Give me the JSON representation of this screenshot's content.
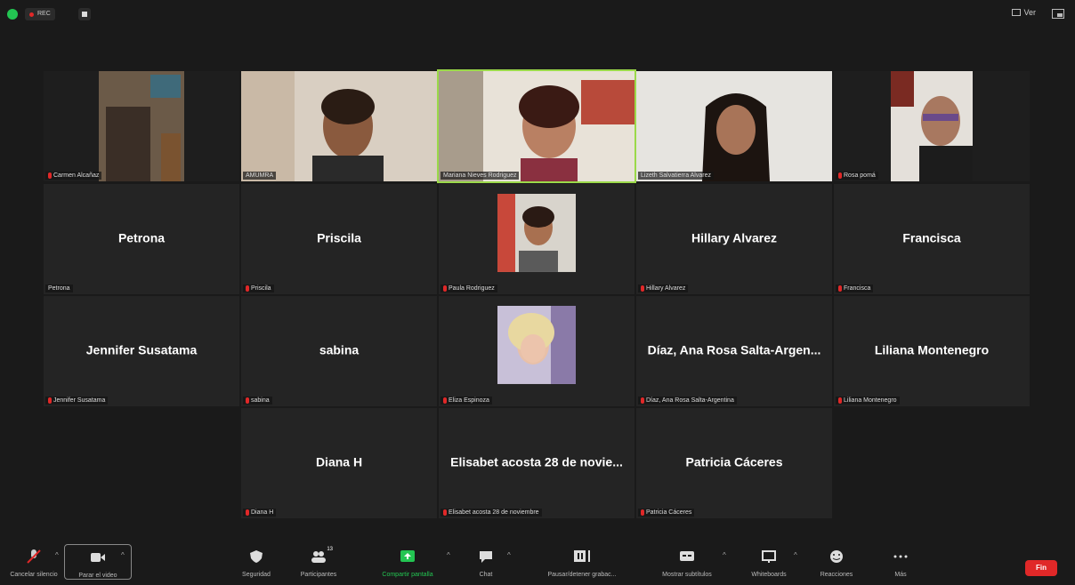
{
  "top_bar": {
    "recording_label": "REC",
    "view_label": "Ver"
  },
  "video_tiles": [
    {
      "name": "Carmen Alcañaz"
    },
    {
      "name": "AMUMRA"
    },
    {
      "name": "Mariana Nieves Rodriguez"
    },
    {
      "name": "Lizeth Salvatierra Alvarez"
    },
    {
      "name": "Rosa pomá"
    }
  ],
  "name_tiles_row2": [
    {
      "display": "Petrona",
      "tag": "Petrona"
    },
    {
      "display": "Priscila",
      "tag": "Priscila"
    },
    {
      "display": "",
      "tag": "Paula Rodriguez"
    },
    {
      "display": "Hillary Alvarez",
      "tag": "Hillary Alvarez"
    },
    {
      "display": "Francisca",
      "tag": "Francisca"
    }
  ],
  "name_tiles_row3": [
    {
      "display": "Jennifer Susatama",
      "tag": "Jennifer Susatama"
    },
    {
      "display": "sabina",
      "tag": "sabina"
    },
    {
      "display": "",
      "tag": "Eliza Espinoza"
    },
    {
      "display": "Díaz, Ana Rosa Salta-Argen...",
      "tag": "Díaz, Ana Rosa Salta-Argentina"
    },
    {
      "display": "Liliana Montenegro",
      "tag": "Liliana Montenegro"
    }
  ],
  "name_tiles_row4": [
    {
      "display": "Diana H",
      "tag": "Diana H"
    },
    {
      "display": "Elisabet acosta 28 de novie...",
      "tag": "Elisabet acosta 28 de noviembre"
    },
    {
      "display": "Patricia Cáceres",
      "tag": "Patricia Cáceres"
    }
  ],
  "toolbar": {
    "mute_label": "Cancelar silencio",
    "video_label": "Parar el video",
    "security_label": "Seguridad",
    "participants_label": "Participantes",
    "participants_count": "13",
    "share_label": "Compartir pantalla",
    "chat_label": "Chat",
    "record_label": "Pausar/detener grabac...",
    "captions_label": "Mostrar subtítulos",
    "whiteboards_label": "Whiteboards",
    "reactions_label": "Reacciones",
    "more_label": "Más",
    "end_label": "Fin"
  },
  "colors": {
    "active_speaker_border": "#9bd94a",
    "muted_mic": "#e02828",
    "end_button": "#e02828",
    "share_icon": "#23c552"
  }
}
